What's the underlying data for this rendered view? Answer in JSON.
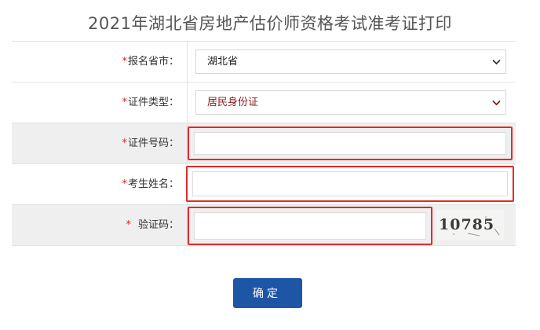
{
  "page": {
    "title": "2021年湖北省房地产估价师资格考试准考证打印"
  },
  "form": {
    "province": {
      "required_mark": "*",
      "label": "报名省市：",
      "selected": "湖北省"
    },
    "id_type": {
      "required_mark": "*",
      "label": "证件类型：",
      "selected": "居民身份证"
    },
    "id_number": {
      "required_mark": "*",
      "label": "证件号码：",
      "value": ""
    },
    "name": {
      "required_mark": "*",
      "label": "考生姓名：",
      "value": ""
    },
    "captcha": {
      "required_mark": "*",
      "label": "验证码：",
      "value": "",
      "image_text": "10785"
    }
  },
  "submit": {
    "label": "确定"
  },
  "colors": {
    "accent": "#1e56a6",
    "highlight_border": "#e02b2b",
    "required": "#e02020"
  }
}
